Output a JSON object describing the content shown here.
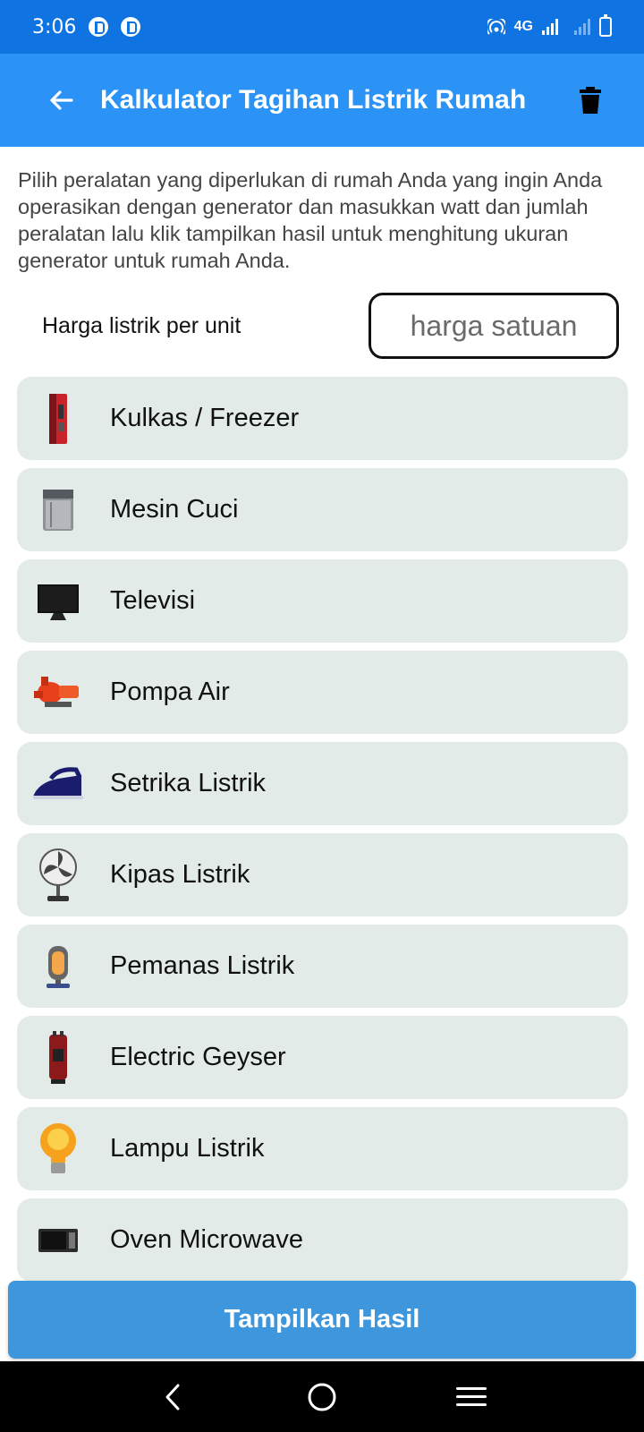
{
  "status_bar": {
    "time": "3:06",
    "network": "4G"
  },
  "app_bar": {
    "title": "Kalkulator Tagihan Listrik Rumah",
    "back_icon": "arrow-left-icon",
    "action_icon": "trash-icon"
  },
  "intro": {
    "text": "Pilih peralatan yang diperlukan di rumah Anda yang ingin Anda operasikan dengan generator dan masukkan watt dan jumlah peralatan lalu klik tampilkan hasil untuk menghitung ukuran generator untuk rumah Anda."
  },
  "price": {
    "label": "Harga listrik per unit",
    "value": "",
    "placeholder": "harga satuan"
  },
  "appliances": [
    {
      "label": "Kulkas / Freezer",
      "icon": "refrigerator-icon"
    },
    {
      "label": "Mesin Cuci",
      "icon": "washing-machine-icon"
    },
    {
      "label": "Televisi",
      "icon": "television-icon"
    },
    {
      "label": "Pompa Air",
      "icon": "water-pump-icon"
    },
    {
      "label": "Setrika Listrik",
      "icon": "iron-icon"
    },
    {
      "label": "Kipas Listrik",
      "icon": "fan-icon"
    },
    {
      "label": "Pemanas Listrik",
      "icon": "heater-icon"
    },
    {
      "label": "Electric Geyser",
      "icon": "geyser-icon"
    },
    {
      "label": "Lampu Listrik",
      "icon": "light-bulb-icon"
    },
    {
      "label": "Oven Microwave",
      "icon": "microwave-icon"
    }
  ],
  "action": {
    "label": "Tampilkan Hasil"
  },
  "colors": {
    "status_bar": "#0f74e2",
    "app_bar": "#2b93f6",
    "item_bg": "#e3ebe9",
    "button": "#3e96dc"
  }
}
